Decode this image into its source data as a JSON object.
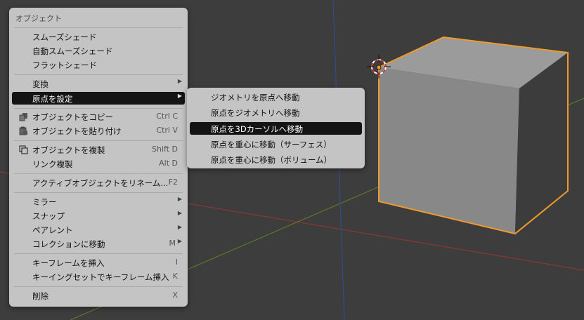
{
  "menu": {
    "title": "オブジェクト",
    "items": [
      {
        "label": "スムーズシェード",
        "shortcut": "",
        "submenu": false,
        "highlighted": false
      },
      {
        "label": "自動スムーズシェード",
        "shortcut": "",
        "submenu": false,
        "highlighted": false
      },
      {
        "label": "フラットシェード",
        "shortcut": "",
        "submenu": false,
        "highlighted": false
      },
      {
        "label": "変換",
        "shortcut": "",
        "submenu": true,
        "highlighted": false
      },
      {
        "label": "原点を設定",
        "shortcut": "",
        "submenu": true,
        "highlighted": true
      },
      {
        "label": "オブジェクトをコピー",
        "shortcut": "Ctrl C",
        "submenu": false,
        "highlighted": false,
        "icon": "copy-icon"
      },
      {
        "label": "オブジェクトを貼り付け",
        "shortcut": "Ctrl V",
        "submenu": false,
        "highlighted": false,
        "icon": "paste-icon"
      },
      {
        "label": "オブジェクトを複製",
        "shortcut": "Shift D",
        "submenu": false,
        "highlighted": false,
        "icon": "duplicate-icon"
      },
      {
        "label": "リンク複製",
        "shortcut": "Alt D",
        "submenu": false,
        "highlighted": false
      },
      {
        "label": "アクティブオブジェクトをリネーム...",
        "shortcut": "F2",
        "submenu": false,
        "highlighted": false
      },
      {
        "label": "ミラー",
        "shortcut": "",
        "submenu": true,
        "highlighted": false
      },
      {
        "label": "スナップ",
        "shortcut": "",
        "submenu": true,
        "highlighted": false
      },
      {
        "label": "ペアレント",
        "shortcut": "",
        "submenu": true,
        "highlighted": false
      },
      {
        "label": "コレクションに移動",
        "shortcut": "M",
        "submenu": true,
        "highlighted": false
      },
      {
        "label": "キーフレームを挿入",
        "shortcut": "I",
        "submenu": false,
        "highlighted": false
      },
      {
        "label": "キーイングセットでキーフレーム挿入",
        "shortcut": "K",
        "submenu": false,
        "highlighted": false
      },
      {
        "label": "削除",
        "shortcut": "X",
        "submenu": false,
        "highlighted": false
      }
    ]
  },
  "submenu": {
    "items": [
      {
        "label": "ジオメトリを原点へ移動",
        "highlighted": false
      },
      {
        "label": "原点をジオメトリへ移動",
        "highlighted": false
      },
      {
        "label": "原点を3Dカーソルへ移動",
        "highlighted": true
      },
      {
        "label": "原点を重心に移動（サーフェス）",
        "highlighted": false
      },
      {
        "label": "原点を重心に移動（ボリューム）",
        "highlighted": false
      }
    ]
  },
  "colors": {
    "viewport_bg": "#3d3d3d",
    "x_axis": "#8c3636",
    "y_axis": "#59792a",
    "z_axis": "#2d4f8a",
    "selection_outline": "#ef9a2c",
    "cube_top": "#9b9b9b",
    "cube_front": "#888888",
    "cube_side": "#3c3c3c",
    "menu_bg": "#c4c4c4",
    "menu_highlight": "#141414"
  }
}
